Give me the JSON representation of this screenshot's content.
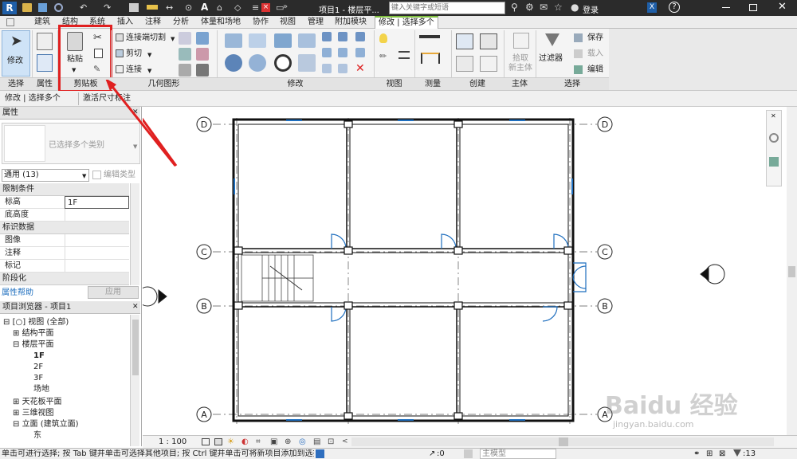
{
  "titlebar": {
    "title": "项目1 - 楼层平...",
    "search_placeholder": "键入关键字或短语",
    "login": "登录",
    "help": "?"
  },
  "tabs": [
    "建筑",
    "结构",
    "系统",
    "插入",
    "注释",
    "分析",
    "体量和场地",
    "协作",
    "视图",
    "管理",
    "附加模块",
    "修改 | 选择多个"
  ],
  "ribbon": {
    "modify_label": "修改",
    "paste_label": "粘贴",
    "join_cut_label": "连接端切割",
    "cut_label": "剪切",
    "connect_label": "连接",
    "pick_host_label": "拾取\n新主体",
    "filter_label": "过滤器",
    "save_label": "保存",
    "load_label": "载入",
    "edit_label": "编辑",
    "groups": [
      "选择",
      "属性",
      "剪贴板",
      "几何图形",
      "修改",
      "视图",
      "测量",
      "创建",
      "主体",
      "选择"
    ]
  },
  "context_bar": {
    "left": "修改 | 选择多个",
    "activate_dims": "激活尺寸标注"
  },
  "properties": {
    "title": "属性",
    "type_selector": "已选择多个类别",
    "filter_value": "通用 (13)",
    "edit_type": "编辑类型",
    "sections": {
      "constraints": "限制条件",
      "identity": "标识数据",
      "phasing": "阶段化"
    },
    "rows": [
      {
        "key": "标高",
        "value": "1F"
      },
      {
        "key": "底高度",
        "value": ""
      },
      {
        "key": "图像",
        "value": ""
      },
      {
        "key": "注释",
        "value": ""
      },
      {
        "key": "标记",
        "value": ""
      }
    ],
    "help_link": "属性帮助",
    "apply_button": "应用"
  },
  "project_browser": {
    "title": "项目浏览器 - 项目1",
    "items": [
      {
        "label": "视图 (全部)",
        "level": 0
      },
      {
        "label": "结构平面",
        "level": 1
      },
      {
        "label": "楼层平面",
        "level": 1
      },
      {
        "label": "1F",
        "level": 2
      },
      {
        "label": "2F",
        "level": 2
      },
      {
        "label": "3F",
        "level": 2
      },
      {
        "label": "场地",
        "level": 2
      },
      {
        "label": "天花板平面",
        "level": 1
      },
      {
        "label": "三维视图",
        "level": 1
      },
      {
        "label": "立面 (建筑立面)",
        "level": 1
      },
      {
        "label": "东",
        "level": 2
      }
    ]
  },
  "grid_labels": {
    "top": "D",
    "c": "C",
    "b": "B",
    "a": "A"
  },
  "viewbar": {
    "scale": "1 : 100"
  },
  "status": {
    "message": "单击可进行选择; 按 Tab 键并单击可选择其他项目; 按 Ctrl 键并单击可将新项目添加到选择",
    "zero": ":0",
    "model": "主模型",
    "count": ":13"
  },
  "watermark": {
    "brand": "Baidu 经验",
    "url": "jingyan.baidu.com"
  },
  "colors": {
    "highlight": "#e02020",
    "accent_blue": "#1f6fbf",
    "context_tab": "#7fbf3f"
  }
}
